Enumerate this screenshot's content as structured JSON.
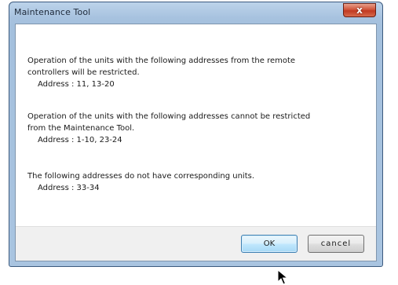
{
  "window": {
    "title": "Maintenance Tool",
    "close_glyph": "x"
  },
  "messages": [
    {
      "lines": [
        "Operation of the units with the following addresses from the remote",
        "controllers will be restricted."
      ],
      "address": "Address : 11, 13-20"
    },
    {
      "lines": [
        "Operation of the units with the following addresses cannot be restricted",
        "from the Maintenance Tool."
      ],
      "address": "Address : 1-10, 23-24"
    },
    {
      "lines": [
        "The following addresses do not have corresponding units."
      ],
      "address": "Address : 33-34"
    }
  ],
  "buttons": {
    "ok": "OK",
    "cancel": "cancel"
  },
  "icons": {
    "close": "close-icon",
    "pointer": "mouse-pointer-icon"
  },
  "colors": {
    "title_bar": "#a9c4e0",
    "close_button": "#c13a22",
    "ok_border": "#3c7fb1"
  }
}
